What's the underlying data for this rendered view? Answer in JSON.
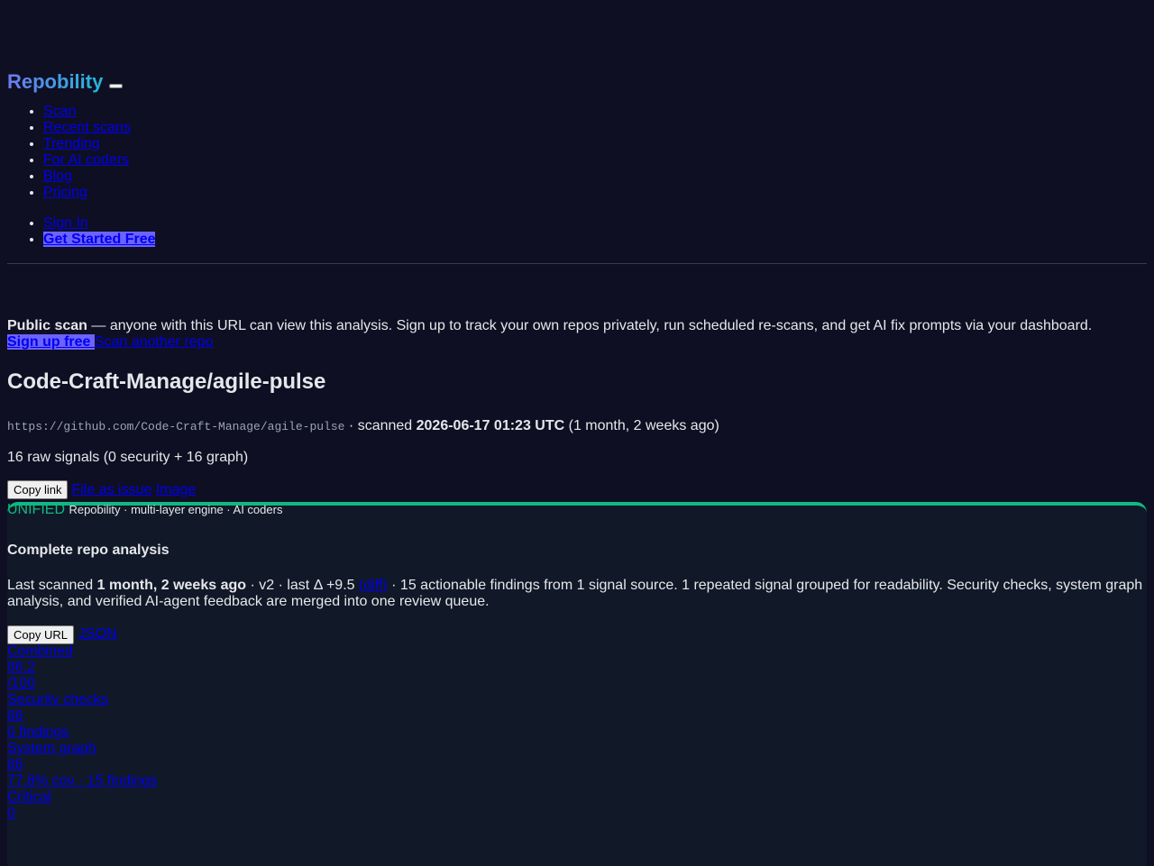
{
  "brand": {
    "name": "Repobility"
  },
  "nav": {
    "items": [
      {
        "label": "Scan"
      },
      {
        "label": "Recent scans"
      },
      {
        "label": "Trending"
      },
      {
        "label": "For AI coders"
      },
      {
        "label": "Blog"
      },
      {
        "label": "Pricing"
      }
    ],
    "sign_in": "Sign In",
    "get_started": "Get Started Free"
  },
  "notice": {
    "strong": "Public scan",
    "text": " — anyone with this URL can view this analysis. Sign up to track your own repos privately, run scheduled re-scans, and get AI fix prompts via your dashboard.",
    "signup_label": "Sign up free ",
    "scan_another_label": "Scan another repo"
  },
  "repo": {
    "title": "Code-Craft-Manage/agile-pulse",
    "url": "https://github.com/Code-Craft-Manage/agile-pulse",
    "scanned_prefix": " · scanned ",
    "scanned_at": "2026-06-17 01:23 UTC",
    "scanned_ago": " (1 month, 2 weeks ago)",
    "signals": "16 raw signals (0 security + 16 graph)"
  },
  "actions": {
    "copy_link": "Copy link",
    "file_issue": "File as issue",
    "image": "Image"
  },
  "card": {
    "badge": "UNIFIED",
    "engine": "Repobility · multi-layer engine · AI coders",
    "heading": "Complete repo analysis",
    "summary_prefix": "Last scanned ",
    "summary_strong": "1 month, 2 weeks ago",
    "summary_mid": " · v2 · last Δ +9.5 ",
    "diff_label": "(diff)",
    "summary_rest": " · 15 actionable findings from 1 signal source. 1 repeated signal grouped for readability. Security checks, system graph analysis, and verified AI-agent feedback are merged into one review queue.",
    "copy_url": "Copy URL",
    "json_label": "JSON"
  },
  "metrics": [
    {
      "label": "Combined",
      "value": "86.2",
      "sub": "/100"
    },
    {
      "label": "Security checks",
      "value": "86",
      "sub": "0 findings"
    },
    {
      "label": "System graph",
      "value": "86",
      "sub": "77.8% cov · 15 findings"
    },
    {
      "label": "Critical",
      "value": "0",
      "sub": ""
    }
  ],
  "colors": {
    "background": "#0f0f23",
    "accent_green": "#10b981",
    "cta": "#6c63ff",
    "link": "#0000ee"
  }
}
